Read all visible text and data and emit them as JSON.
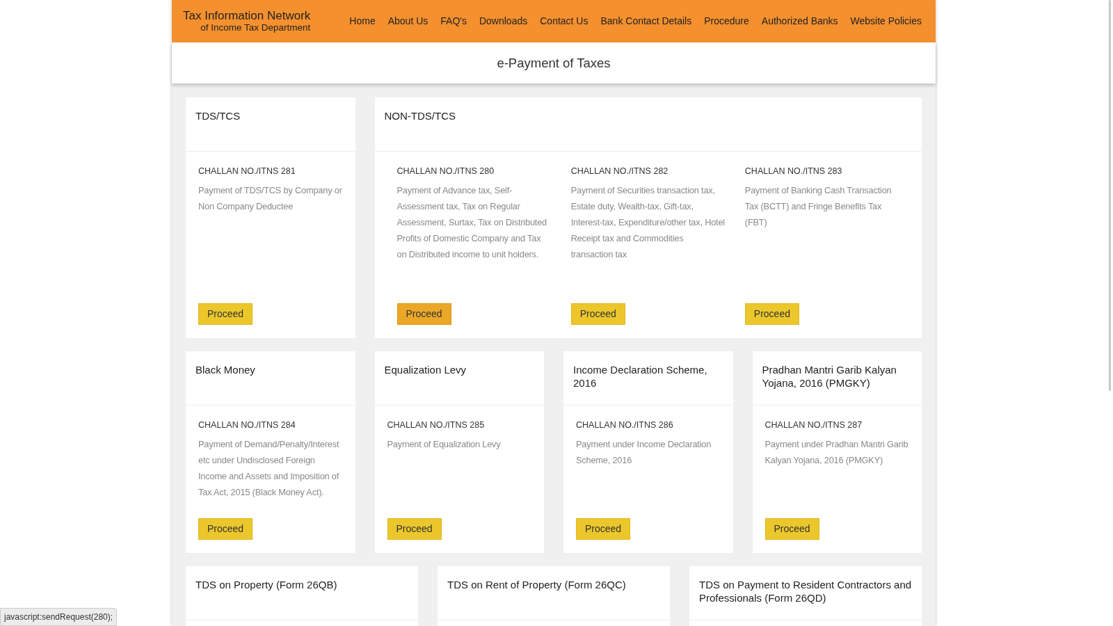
{
  "header": {
    "title": "Tax Information Network",
    "subtitle": "of Income Tax Department",
    "nav": [
      {
        "label": "Home"
      },
      {
        "label": "About Us"
      },
      {
        "label": "FAQ's"
      },
      {
        "label": "Downloads"
      },
      {
        "label": "Contact Us"
      },
      {
        "label": "Bank Contact Details"
      },
      {
        "label": "Procedure"
      },
      {
        "label": "Authorized Banks"
      },
      {
        "label": "Website Policies"
      }
    ]
  },
  "page_title": "e-Payment of Taxes",
  "rows": [
    [
      {
        "title": "TDS/TCS",
        "challans": [
          {
            "number": "CHALLAN NO./ITNS 281",
            "description": "Payment of TDS/TCS by Company or Non Company Deductee",
            "button": "Proceed",
            "hovered": false
          }
        ]
      },
      {
        "title": "NON-TDS/TCS",
        "challans": [
          {
            "number": "CHALLAN NO./ITNS 280",
            "description": "Payment of Advance tax, Self-Assessment tax, Tax on Regular Assessment, Surtax, Tax on Distributed Profits of Domestic Company and Tax on Distributed income to unit holders.",
            "button": "Proceed",
            "hovered": true
          },
          {
            "number": "CHALLAN NO./ITNS 282",
            "description": "Payment of Securities transaction tax, Estate duty, Wealth-tax, Gift-tax, Interest-tax, Expenditure/other tax, Hotel Receipt tax and Commodities transaction tax",
            "button": "Proceed",
            "hovered": false
          },
          {
            "number": "CHALLAN NO./ITNS 283",
            "description": "Payment of Banking Cash Transaction Tax (BCTT) and Fringe Benefits Tax (FBT)",
            "button": "Proceed",
            "hovered": false
          }
        ]
      }
    ],
    [
      {
        "title": "Black Money",
        "challans": [
          {
            "number": "CHALLAN NO./ITNS 284",
            "description": "Payment of Demand/Penalty/Interest etc under Undisclosed Foreign Income and Assets and Imposition of Tax Act, 2015 (Black Money Act).",
            "button": "Proceed",
            "hovered": false
          }
        ]
      },
      {
        "title": "Equalization Levy",
        "challans": [
          {
            "number": "CHALLAN NO./ITNS 285",
            "description": "Payment of Equalization Levy",
            "button": "Proceed",
            "hovered": false
          }
        ]
      },
      {
        "title": "Income Declaration Scheme, 2016",
        "challans": [
          {
            "number": "CHALLAN NO./ITNS 286",
            "description": "Payment under Income Declaration Scheme, 2016",
            "button": "Proceed",
            "hovered": false
          }
        ]
      },
      {
        "title": "Pradhan Mantri Garib Kalyan Yojana, 2016 (PMGKY)",
        "challans": [
          {
            "number": "CHALLAN NO./ITNS 287",
            "description": "Payment under Pradhan Mantri Garib Kalyan Yojana, 2016 (PMGKY)",
            "button": "Proceed",
            "hovered": false
          }
        ]
      }
    ],
    [
      {
        "title": "TDS on Property (Form 26QB)"
      },
      {
        "title": "TDS on Rent of Property (Form 26QC)"
      },
      {
        "title": "TDS on Payment to Resident Contractors and Professionals (Form 26QD)"
      }
    ]
  ],
  "status_bar": "javascript:sendRequest(280);"
}
